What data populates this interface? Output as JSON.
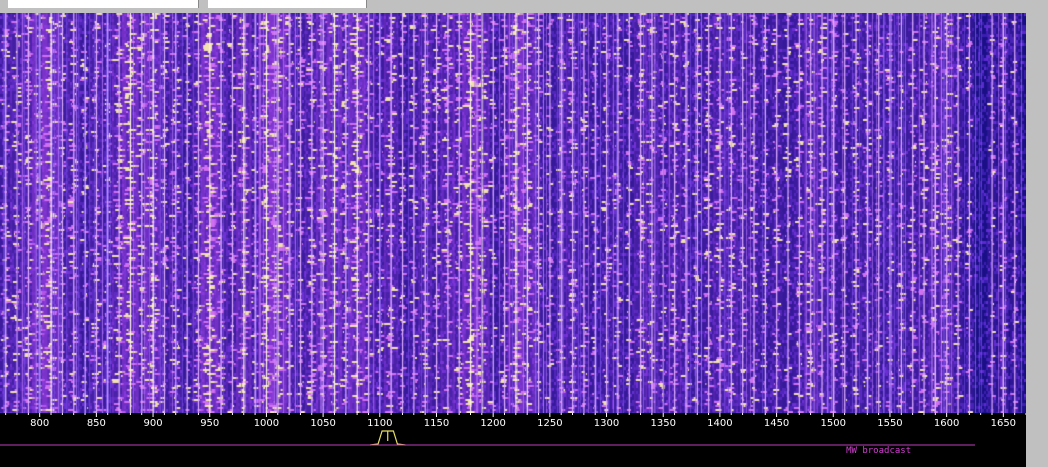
{
  "top_bar": {
    "field_a_value": "",
    "field_b_value": ""
  },
  "frequency_scale": {
    "unit": "kHz",
    "min": 765,
    "max": 1670,
    "tick_labels": [
      "800",
      "850",
      "900",
      "950",
      "1000",
      "1050",
      "1100",
      "1150",
      "1200",
      "1250",
      "1300",
      "1350",
      "1400",
      "1450",
      "1500",
      "1550",
      "1600",
      "1650"
    ],
    "minor_step": 10
  },
  "passband_marker": {
    "center": 1107,
    "width": 10,
    "color": "#e8e060"
  },
  "band_label": {
    "text": "MW broadcast",
    "color": "#d040d0",
    "start": 765,
    "end": 1625
  },
  "colors": {
    "waterfall_base": "#1a0f86",
    "signal_mid": "#9a3fe0",
    "signal_strong": "#f2e0b0",
    "scale_bg": "#000000",
    "scale_text": "#ffffff",
    "band_line": "#c040c0"
  },
  "signals": [
    {
      "f": 770,
      "s": 0.5
    },
    {
      "f": 780,
      "s": 0.6
    },
    {
      "f": 790,
      "s": 0.7
    },
    {
      "f": 800,
      "s": 0.8
    },
    {
      "f": 810,
      "s": 1.0
    },
    {
      "f": 820,
      "s": 0.5
    },
    {
      "f": 830,
      "s": 0.6
    },
    {
      "f": 840,
      "s": 0.4
    },
    {
      "f": 850,
      "s": 0.6
    },
    {
      "f": 860,
      "s": 0.5
    },
    {
      "f": 870,
      "s": 0.7
    },
    {
      "f": 880,
      "s": 0.9
    },
    {
      "f": 890,
      "s": 0.6
    },
    {
      "f": 900,
      "s": 0.9
    },
    {
      "f": 910,
      "s": 0.5
    },
    {
      "f": 920,
      "s": 0.6
    },
    {
      "f": 930,
      "s": 0.4
    },
    {
      "f": 940,
      "s": 0.6
    },
    {
      "f": 950,
      "s": 1.0
    },
    {
      "f": 960,
      "s": 0.6
    },
    {
      "f": 970,
      "s": 0.5
    },
    {
      "f": 980,
      "s": 0.8
    },
    {
      "f": 990,
      "s": 0.5
    },
    {
      "f": 1000,
      "s": 0.9
    },
    {
      "f": 1010,
      "s": 1.0
    },
    {
      "f": 1020,
      "s": 0.6
    },
    {
      "f": 1030,
      "s": 0.5
    },
    {
      "f": 1040,
      "s": 0.6
    },
    {
      "f": 1050,
      "s": 0.7
    },
    {
      "f": 1060,
      "s": 0.8
    },
    {
      "f": 1070,
      "s": 0.6
    },
    {
      "f": 1080,
      "s": 0.9
    },
    {
      "f": 1090,
      "s": 0.6
    },
    {
      "f": 1100,
      "s": 0.5
    },
    {
      "f": 1110,
      "s": 0.7
    },
    {
      "f": 1120,
      "s": 0.4
    },
    {
      "f": 1130,
      "s": 0.5
    },
    {
      "f": 1140,
      "s": 0.6
    },
    {
      "f": 1150,
      "s": 0.5
    },
    {
      "f": 1160,
      "s": 0.7
    },
    {
      "f": 1170,
      "s": 0.6
    },
    {
      "f": 1180,
      "s": 0.9
    },
    {
      "f": 1190,
      "s": 0.8
    },
    {
      "f": 1200,
      "s": 0.4
    },
    {
      "f": 1210,
      "s": 0.5
    },
    {
      "f": 1220,
      "s": 0.9
    },
    {
      "f": 1230,
      "s": 0.8
    },
    {
      "f": 1240,
      "s": 0.5
    },
    {
      "f": 1250,
      "s": 0.4
    },
    {
      "f": 1260,
      "s": 0.5
    },
    {
      "f": 1270,
      "s": 0.6
    },
    {
      "f": 1280,
      "s": 0.5
    },
    {
      "f": 1290,
      "s": 0.4
    },
    {
      "f": 1300,
      "s": 0.5
    },
    {
      "f": 1310,
      "s": 0.5
    },
    {
      "f": 1320,
      "s": 0.4
    },
    {
      "f": 1330,
      "s": 0.6
    },
    {
      "f": 1340,
      "s": 0.6
    },
    {
      "f": 1350,
      "s": 0.5
    },
    {
      "f": 1360,
      "s": 0.6
    },
    {
      "f": 1370,
      "s": 0.5
    },
    {
      "f": 1380,
      "s": 0.4
    },
    {
      "f": 1390,
      "s": 0.5
    },
    {
      "f": 1400,
      "s": 0.6
    },
    {
      "f": 1410,
      "s": 0.6
    },
    {
      "f": 1420,
      "s": 0.5
    },
    {
      "f": 1430,
      "s": 0.5
    },
    {
      "f": 1440,
      "s": 0.4
    },
    {
      "f": 1450,
      "s": 0.5
    },
    {
      "f": 1460,
      "s": 0.4
    },
    {
      "f": 1470,
      "s": 0.5
    },
    {
      "f": 1480,
      "s": 0.6
    },
    {
      "f": 1490,
      "s": 0.6
    },
    {
      "f": 1500,
      "s": 0.5
    },
    {
      "f": 1510,
      "s": 0.4
    },
    {
      "f": 1520,
      "s": 0.5
    },
    {
      "f": 1530,
      "s": 0.5
    },
    {
      "f": 1540,
      "s": 0.4
    },
    {
      "f": 1550,
      "s": 0.5
    },
    {
      "f": 1560,
      "s": 0.4
    },
    {
      "f": 1570,
      "s": 0.5
    },
    {
      "f": 1580,
      "s": 0.5
    },
    {
      "f": 1590,
      "s": 0.6
    },
    {
      "f": 1600,
      "s": 0.7
    },
    {
      "f": 1610,
      "s": 0.4
    },
    {
      "f": 1620,
      "s": 0.3
    },
    {
      "f": 1640,
      "s": 0.3
    },
    {
      "f": 1650,
      "s": 0.4
    },
    {
      "f": 1660,
      "s": 0.3
    }
  ]
}
